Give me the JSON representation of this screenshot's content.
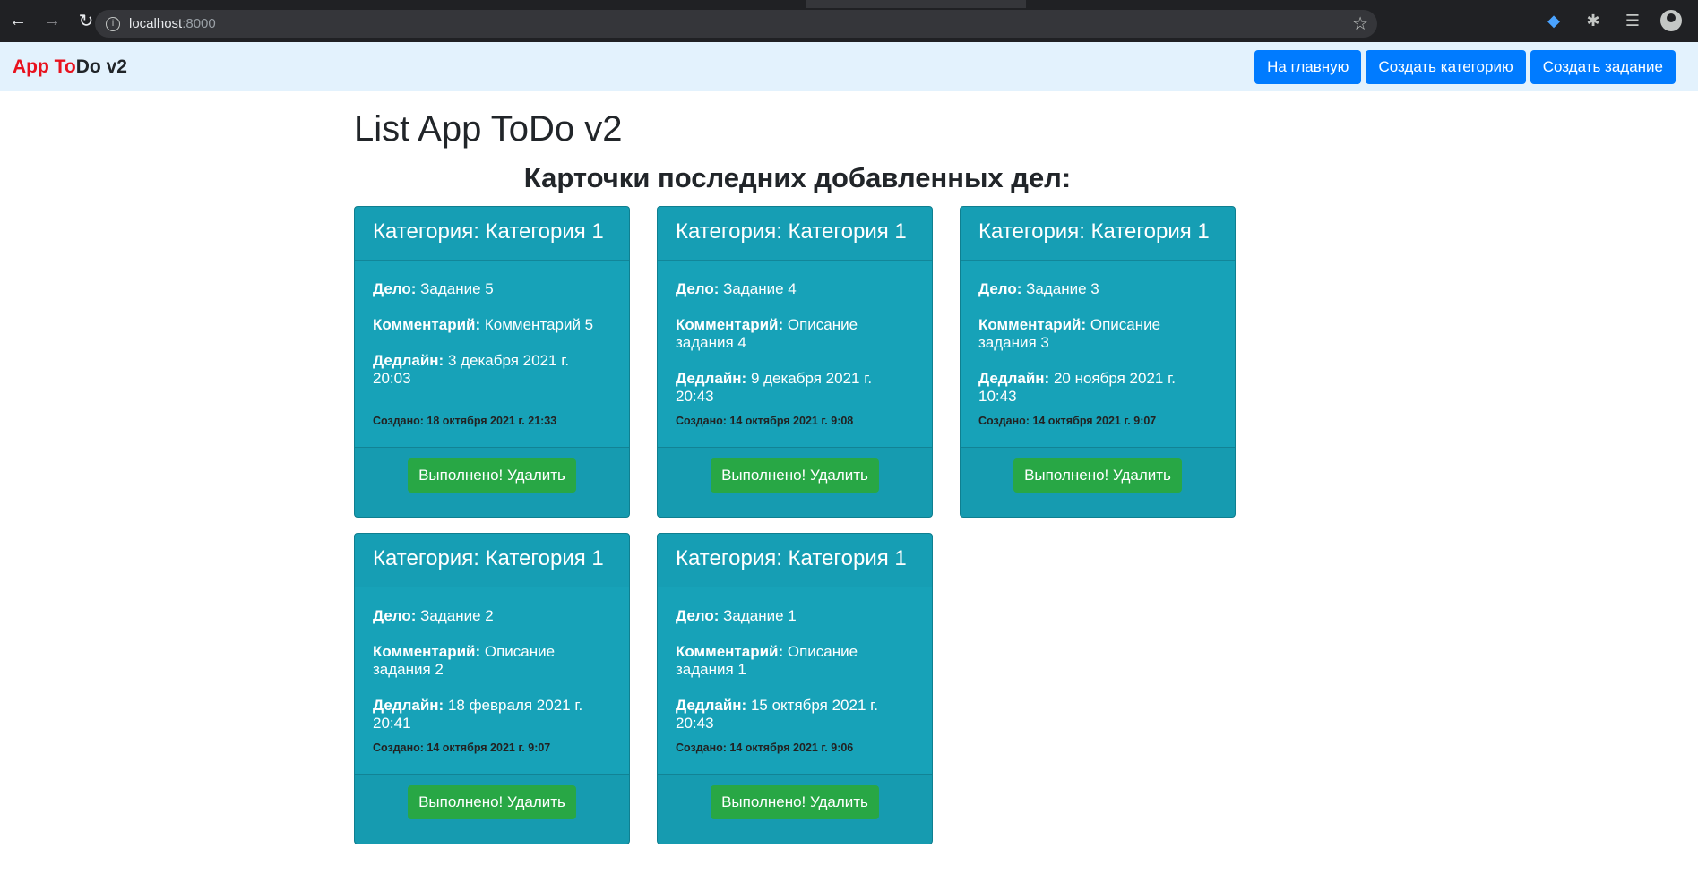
{
  "browser": {
    "url_host": "localhost",
    "url_port": ":8000"
  },
  "navbar": {
    "brand_part1": "App To",
    "brand_part2": "Do v2",
    "buttons": [
      "На главную",
      "Создать категорию",
      "Создать задание"
    ]
  },
  "main": {
    "title": "List App ToDo v2",
    "section_title": "Карточки последних добавленных дел:",
    "labels": {
      "task": "Дело:",
      "comment": "Комментарий:",
      "deadline": "Дедлайн:"
    },
    "done_button": "Выполнено! Удалить",
    "cards": [
      {
        "category": "Категория: Категория 1",
        "task": "Задание 5",
        "comment": "Комментарий 5",
        "deadline": "3 декабря 2021 г. 20:03",
        "created": "Создано: 18 октября 2021 г. 21:33"
      },
      {
        "category": "Категория: Категория 1",
        "task": "Задание 4",
        "comment": "Описание задания 4",
        "deadline": "9 декабря 2021 г. 20:43",
        "created": "Создано: 14 октября 2021 г. 9:08"
      },
      {
        "category": "Категория: Категория 1",
        "task": "Задание 3",
        "comment": "Описание задания 3",
        "deadline": "20 ноября 2021 г. 10:43",
        "created": "Создано: 14 октября 2021 г. 9:07"
      },
      {
        "category": "Категория: Категория 1",
        "task": "Задание 2",
        "comment": "Описание задания 2",
        "deadline": "18 февраля 2021 г. 20:41",
        "created": "Создано: 14 октября 2021 г. 9:07"
      },
      {
        "category": "Категория: Категория 1",
        "task": "Задание 1",
        "comment": "Описание задания 1",
        "deadline": "15 октября 2021 г. 20:43",
        "created": "Создано: 14 октября 2021 г. 9:06"
      }
    ]
  }
}
